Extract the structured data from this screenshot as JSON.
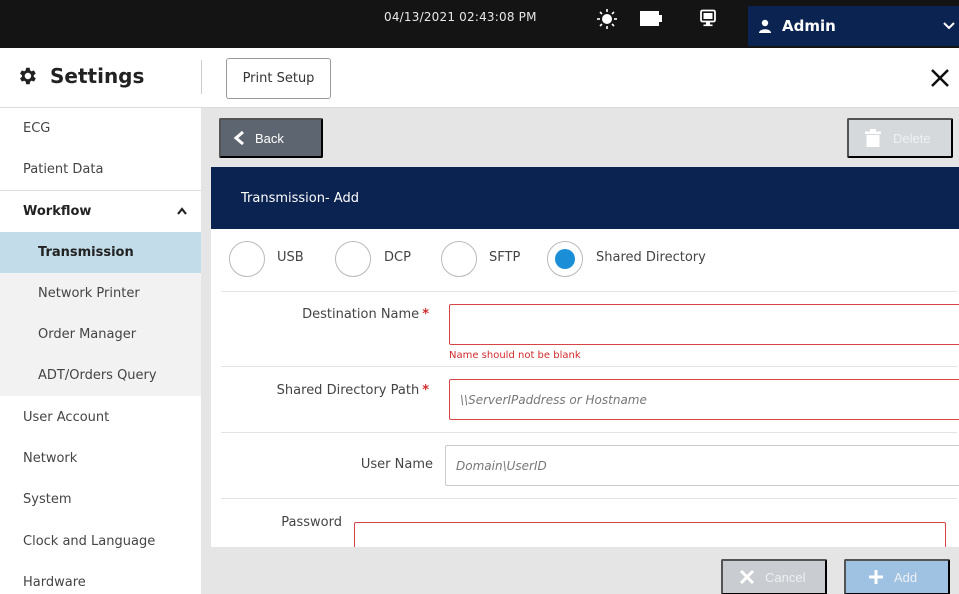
{
  "status_bar": {
    "datetime": "04/13/2021 02:43:08 PM",
    "icons": [
      "brightness-icon",
      "battery-icon",
      "display-icon",
      "user-icon",
      "chevron-down-icon"
    ],
    "user": "Admin"
  },
  "header": {
    "title": "Settings",
    "print_setup_label": "Print Setup",
    "icons": [
      "gear-icon",
      "close-icon"
    ]
  },
  "sidebar": {
    "items": [
      {
        "label": "ECG"
      },
      {
        "label": "Patient Data"
      },
      {
        "label": "Workflow",
        "expanded": true
      },
      {
        "label": "Transmission",
        "selected": true
      },
      {
        "label": "Network Printer"
      },
      {
        "label": "Order Manager"
      },
      {
        "label": "ADT/Orders Query"
      },
      {
        "label": "User Account"
      },
      {
        "label": "Network"
      },
      {
        "label": "System"
      },
      {
        "label": "Clock and Language"
      },
      {
        "label": "Hardware"
      }
    ]
  },
  "toolbar": {
    "back_label": "Back",
    "delete_label": "Delete",
    "delete_enabled": false
  },
  "panel": {
    "title": "Transmission- Add"
  },
  "transport": {
    "options": [
      {
        "label": "USB",
        "checked": false
      },
      {
        "label": "DCP",
        "checked": false
      },
      {
        "label": "SFTP",
        "checked": false
      },
      {
        "label": "Shared Directory",
        "checked": true
      }
    ]
  },
  "form": {
    "destination_name": {
      "label": "Destination Name",
      "required": true,
      "value": "",
      "error": "Name should not be blank"
    },
    "shared_directory_path": {
      "label": "Shared Directory Path",
      "required": true,
      "value": "",
      "placeholder": "\\\\ServerIPaddress or Hostname"
    },
    "user_name": {
      "label": "User Name",
      "required": false,
      "value": "",
      "placeholder": "Domain\\UserID"
    },
    "password": {
      "label": "Password",
      "value": ""
    }
  },
  "footer": {
    "cancel_label": "Cancel",
    "add_label": "Add"
  },
  "colors": {
    "accent_blue": "#0b2350",
    "selected_nav": "#c2dde9",
    "radio_selected": "#1a8fd8",
    "error": "#d22b2b"
  }
}
